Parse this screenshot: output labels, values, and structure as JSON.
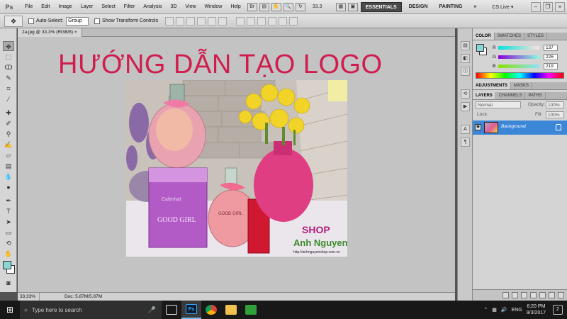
{
  "app": {
    "logo": "Ps"
  },
  "menu": [
    "File",
    "Edit",
    "Image",
    "Layer",
    "Select",
    "Filter",
    "Analysis",
    "3D",
    "View",
    "Window",
    "Help"
  ],
  "menubar": {
    "zoom": "33.3",
    "workspaces": [
      "ESSENTIALS",
      "DESIGN",
      "PAINTING",
      "»"
    ],
    "cs_live": "CS Live ▾"
  },
  "options": {
    "auto_select_label": "Auto-Select:",
    "auto_select_value": "Group",
    "transform_label": "Show Transform Controls"
  },
  "document": {
    "tab_title": "2a.jpg @ 33.3% (RGB/8)",
    "title_text": "HƯỚNG  DẪN TẠO LOGO",
    "photo_text": {
      "brand_box": "GOOD GIRL",
      "bottle_label": "GOOD GIRL",
      "box_brand": "Calimhat",
      "shop": "SHOP",
      "shop_name": "Anh Nguyen",
      "shop_url": "http://anhnguyenshop.com.vn"
    }
  },
  "status": {
    "zoom": "33.33%",
    "doc": "Doc: 5.87M/5.87M"
  },
  "panels": {
    "color_tabs": [
      "COLOR",
      "SWATCHES",
      "STYLES"
    ],
    "color": {
      "r_label": "R",
      "g_label": "G",
      "b_label": "B",
      "r": "137",
      "g": "226",
      "b": "219"
    },
    "adj_tabs": [
      "ADJUSTMENTS",
      "MASKS"
    ],
    "layer_tabs": [
      "LAYERS",
      "CHANNELS",
      "PATHS"
    ],
    "blend_mode": "Normal",
    "opacity_label": "Opacity:",
    "opacity": "100%",
    "lock_label": "Lock:",
    "fill_label": "Fill:",
    "fill": "100%",
    "layer_name": "Background"
  },
  "taskbar": {
    "search_placeholder": "Type here to search",
    "apps": [
      "Ps"
    ],
    "tray": {
      "lang": "ENG",
      "time": "6:20 PM",
      "date": "9/3/2017",
      "notifications": "2"
    }
  },
  "colors": {
    "foreground": "#89d8d5",
    "title_red": "#d01d4e",
    "layer_selected": "#3c86d8"
  }
}
